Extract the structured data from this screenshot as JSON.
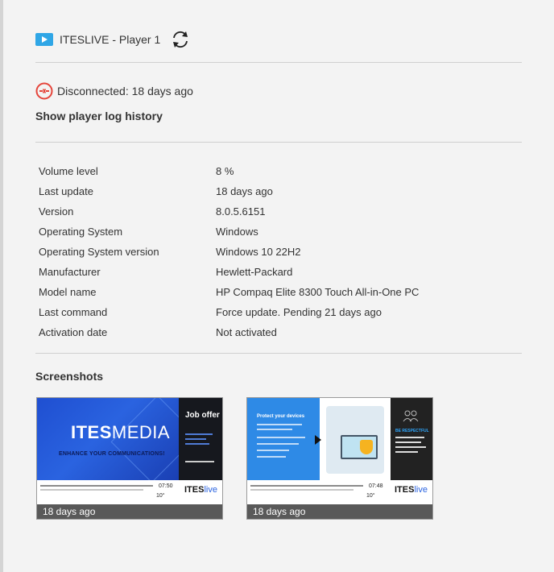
{
  "header": {
    "player_name": "ITESLIVE - Player 1"
  },
  "status": {
    "text": "Disconnected: 18 days ago"
  },
  "log_link": "Show player log history",
  "info": [
    {
      "label": "Volume level",
      "value": "8 %"
    },
    {
      "label": "Last update",
      "value": "18 days ago"
    },
    {
      "label": "Version",
      "value": "8.0.5.6151"
    },
    {
      "label": "Operating System",
      "value": "Windows"
    },
    {
      "label": "Operating System version",
      "value": "Windows 10 22H2"
    },
    {
      "label": "Manufacturer",
      "value": "Hewlett-Packard"
    },
    {
      "label": "Model name",
      "value": "HP Compaq Elite 8300 Touch All-in-One PC"
    },
    {
      "label": "Last command",
      "value": "Force update. Pending 21 days ago"
    },
    {
      "label": "Activation date",
      "value": "Not activated"
    }
  ],
  "screenshots": {
    "title": "Screenshots",
    "items": [
      {
        "caption": "18 days ago",
        "brand_bold": "ITES",
        "brand_light": "MEDIA",
        "slogan": "ENHANCE YOUR COMMUNICATIONS!",
        "side_title": "Job offer",
        "time": "07:50",
        "temp": "10",
        "logo_bold": "ITES",
        "logo_light": "live"
      },
      {
        "caption": "18 days ago",
        "title": "Protect your devices",
        "side_title": "BE RESPECTFUL",
        "time": "07:48",
        "temp": "10",
        "logo_bold": "ITES",
        "logo_light": "live"
      }
    ]
  },
  "colors": {
    "accent_blue": "#2fa6e6",
    "disconnected_red": "#e5453b"
  }
}
